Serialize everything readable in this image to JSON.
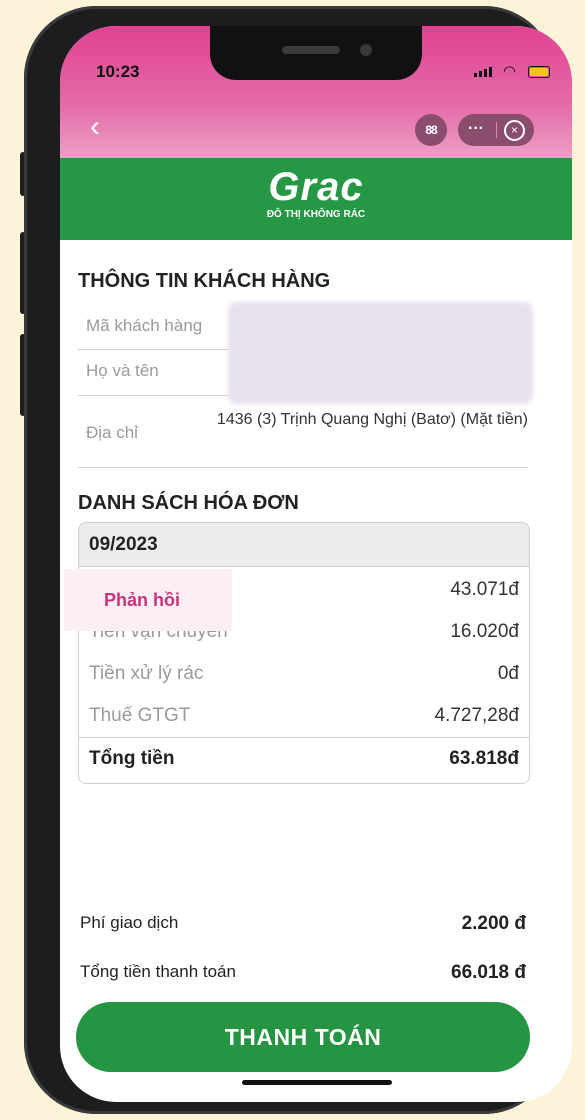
{
  "status_bar": {
    "time": "10:23"
  },
  "nav": {
    "back": "‹",
    "qr": "88",
    "more": "···",
    "close": "×"
  },
  "header": {
    "logo": "Grac",
    "tagline": "ĐÔ THỊ KHÔNG RÁC"
  },
  "customer_info": {
    "title": "THÔNG TIN KHÁCH HÀNG",
    "code_label": "Mã khách hàng",
    "name_label": "Họ và tên",
    "address_label": "Địa chỉ",
    "address_value": "1436 (3) Trịnh Quang Nghị (Batơ) (Mặt tiền)"
  },
  "invoices": {
    "title": "DANH SÁCH HÓA ĐƠN",
    "period": "09/2023",
    "rows": [
      {
        "label": "",
        "value": "43.071đ"
      },
      {
        "label": "Tiền vận chuyển",
        "value": "16.020đ"
      },
      {
        "label": "Tiền xử lý rác",
        "value": "0đ"
      },
      {
        "label": "Thuế GTGT",
        "value": "4.727,28đ"
      }
    ],
    "total_label": "Tổng tiền",
    "total_value": "63.818đ",
    "feedback_label": "Phản hồi"
  },
  "summary": {
    "fee_label": "Phí giao dịch",
    "fee_value": "2.200 đ",
    "total_label": "Tổng tiền thanh toán",
    "total_value": "66.018 đ"
  },
  "pay_button": "THANH TOÁN",
  "colors": {
    "brand_green": "#269845",
    "topbar_pink": "#e0428f",
    "feedback_pink": "#c9337c"
  }
}
